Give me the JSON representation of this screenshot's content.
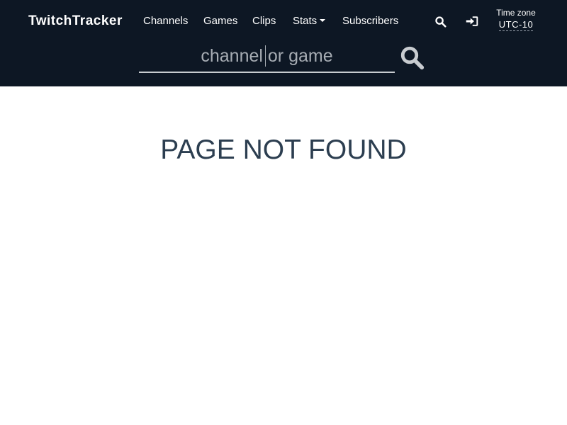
{
  "navbar": {
    "brand": "TwitchTracker",
    "links": [
      {
        "label": "Channels"
      },
      {
        "label": "Games"
      },
      {
        "label": "Clips"
      },
      {
        "label": "Stats"
      },
      {
        "label": "Subscribers"
      }
    ],
    "icons": [
      "search-icon",
      "sign-in-icon"
    ],
    "timezone": {
      "label": "Time zone",
      "value": "UTC-10"
    }
  },
  "search": {
    "placeholder": "channel or game",
    "icon": "search-icon"
  },
  "main": {
    "title": "PAGE NOT FOUND"
  },
  "colors": {
    "navbar_bg": "#0d1724",
    "title": "#2c3e50",
    "placeholder": "#a6acb3"
  }
}
